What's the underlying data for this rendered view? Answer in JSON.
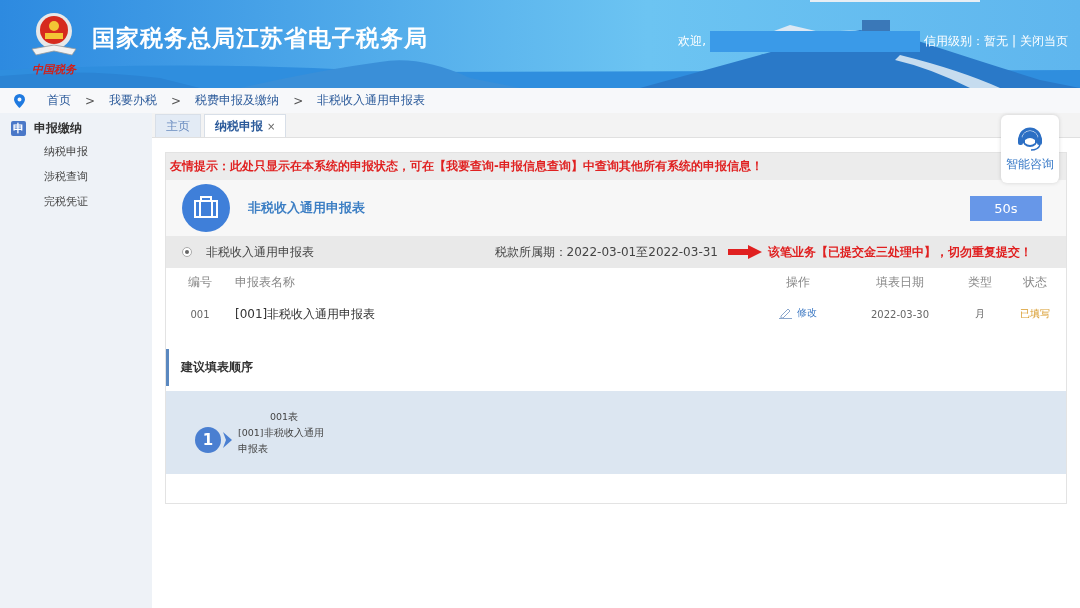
{
  "header": {
    "logo_text": "中国税务",
    "title": "国家税务总局江苏省电子税务局",
    "welcome": "欢迎,",
    "credit": "信用级别：暂无",
    "separator": "|",
    "close": "关闭当页"
  },
  "breadcrumb": {
    "separator": ">",
    "items": [
      "首页",
      "我要办税",
      "税费申报及缴纳",
      "非税收入通用申报表"
    ]
  },
  "sidebar": {
    "icon_text": "申",
    "title": "申报缴纳",
    "items": [
      {
        "label": "纳税申报",
        "selected": false
      },
      {
        "label": "涉税查询",
        "selected": false
      },
      {
        "label": "完税凭证",
        "selected": false
      }
    ]
  },
  "tabs": [
    {
      "label": "主页",
      "selected": false
    },
    {
      "label": "纳税申报",
      "selected": true,
      "close": "×"
    }
  ],
  "consult": {
    "label": "智能咨询"
  },
  "notice": "友情提示：此处只显示在本系统的申报状态，可在【我要查询-申报信息查询】中查询其他所有系统的申报信息！",
  "form": {
    "title": "非税收入通用申报表",
    "countdown": "50s"
  },
  "period_row": {
    "checked": true,
    "name": "非税收入通用申报表",
    "period": "税款所属期：2022-03-01至2022-03-31",
    "warning": "该笔业务【已提交金三处理中】，切勿重复提交！"
  },
  "table": {
    "columns": [
      "编号",
      "申报表名称",
      "操作",
      "填表日期",
      "类型",
      "状态"
    ],
    "rows": [
      {
        "number": "001",
        "name": "[001]非税收入通用申报表",
        "action": "修改",
        "date": "2022-03-30",
        "type": "月",
        "status": "已填写"
      }
    ]
  },
  "suggestion": {
    "title": "建议填表顺序",
    "steps": [
      {
        "number": "1",
        "code": "001表",
        "name": "[001]非税收入通用申报表"
      }
    ]
  }
}
